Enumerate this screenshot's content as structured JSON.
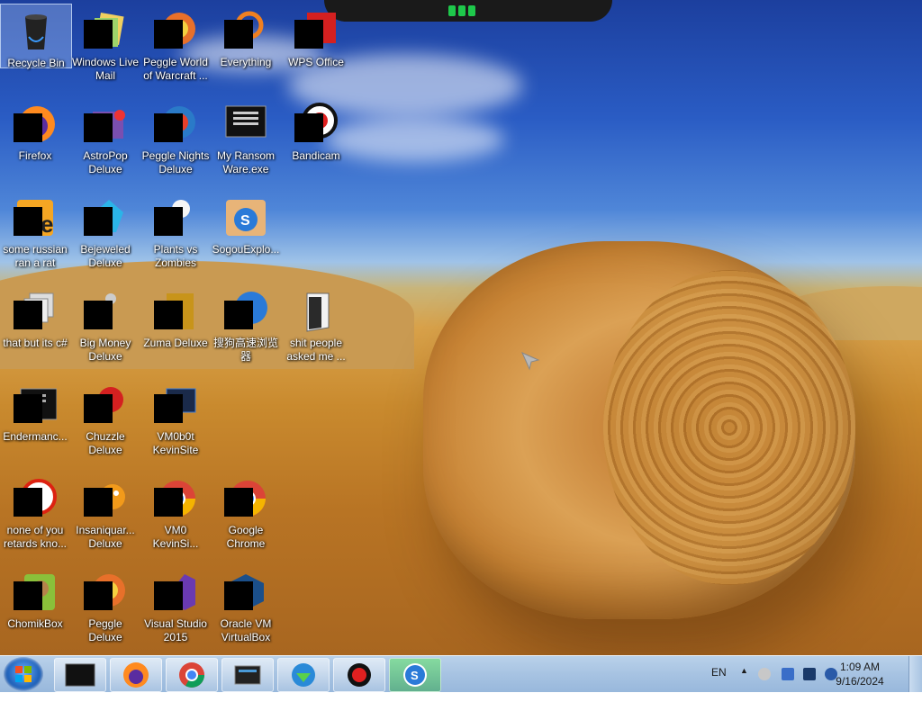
{
  "desktop_icons": [
    {
      "label": "Recycle Bin",
      "icon": "recycle-bin-icon"
    },
    {
      "label": "Windows Live\nMail",
      "icon": "mail-icon"
    },
    {
      "label": "Peggle World\nof Warcraft ...",
      "icon": "peggle-icon"
    },
    {
      "label": "Everything",
      "icon": "search-icon"
    },
    {
      "label": "WPS Office",
      "icon": "wps-office-icon"
    },
    {
      "label": "Firefox",
      "icon": "firefox-icon"
    },
    {
      "label": "AstroPop\nDeluxe",
      "icon": "game-icon"
    },
    {
      "label": "Peggle Nights\nDeluxe",
      "icon": "game-icon"
    },
    {
      "label": "My Ransom\nWare.exe",
      "icon": "executable-icon"
    },
    {
      "label": "Bandicam",
      "icon": "record-icon"
    },
    {
      "label": "some russian\nran a rat",
      "icon": "file-icon"
    },
    {
      "label": "Bejeweled\nDeluxe",
      "icon": "gem-icon"
    },
    {
      "label": "Plants vs\nZombies",
      "icon": "game-icon"
    },
    {
      "label": "SogouExplo...",
      "icon": "browser-icon"
    },
    {
      "label": "that but its c#",
      "icon": "file-icon"
    },
    {
      "label": "Big Money\nDeluxe",
      "icon": "game-icon"
    },
    {
      "label": "Zuma Deluxe",
      "icon": "game-icon"
    },
    {
      "label": "搜狗高速浏览\n器",
      "icon": "browser-icon"
    },
    {
      "label": "shit people\nasked me ...",
      "icon": "folder-icon"
    },
    {
      "label": "Endermanc...",
      "icon": "executable-icon"
    },
    {
      "label": "Chuzzle\nDeluxe",
      "icon": "game-icon"
    },
    {
      "label": "VM0b0t\nKevinSite",
      "icon": "executable-icon"
    },
    {
      "label": "none of you\nretards kno...",
      "icon": "record-icon"
    },
    {
      "label": "Insaniquar...\nDeluxe",
      "icon": "game-icon"
    },
    {
      "label": "VM0\nKevinSi...",
      "icon": "chrome-icon"
    },
    {
      "label": "Google\nChrome",
      "icon": "chrome-icon"
    },
    {
      "label": "ChomikBox",
      "icon": "chomikbox-icon"
    },
    {
      "label": "Peggle Deluxe",
      "icon": "peggle-icon"
    },
    {
      "label": "Visual Studio\n2015",
      "icon": "visual-studio-icon"
    },
    {
      "label": "Oracle VM\nVirtualBox",
      "icon": "virtualbox-icon"
    }
  ],
  "taskbar": {
    "pinned": [
      {
        "name": "terminal",
        "icon": "terminal-icon"
      },
      {
        "name": "firefox",
        "icon": "firefox-icon"
      },
      {
        "name": "chrome",
        "icon": "chrome-icon"
      },
      {
        "name": "explorer",
        "icon": "window-icon"
      },
      {
        "name": "internet-download-manager",
        "icon": "download-icon"
      },
      {
        "name": "bandicam",
        "icon": "record-icon"
      },
      {
        "name": "sogou-browser",
        "icon": "browser-icon"
      }
    ],
    "language": "EN",
    "time": "1:09 AM",
    "date": "9/16/2024"
  },
  "colors": {
    "taskbar_bg": "#a7c3e2",
    "active_taskbar_item": "#3caa5a"
  }
}
